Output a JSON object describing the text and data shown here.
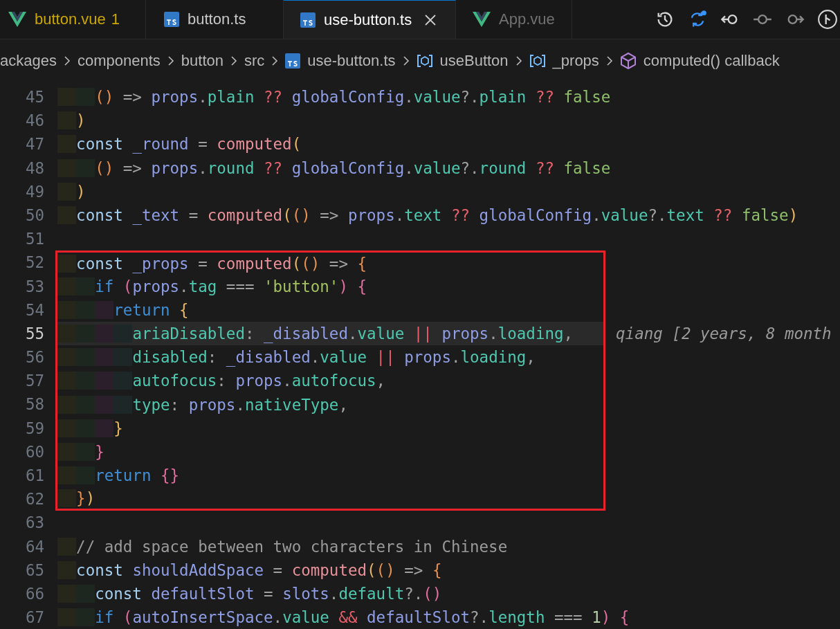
{
  "tabs": [
    {
      "label": "button.vue",
      "kind": "vue",
      "badge": "1",
      "selected": false,
      "dimmed": false
    },
    {
      "label": "button.ts",
      "kind": "ts",
      "selected": false,
      "dimmed": false
    },
    {
      "label": "use-button.ts",
      "kind": "ts",
      "selected": true,
      "dimmed": false
    },
    {
      "label": "App.vue",
      "kind": "vue",
      "selected": false,
      "dimmed": true
    }
  ],
  "breadcrumb": [
    {
      "kind": "folder",
      "label": "ackages"
    },
    {
      "kind": "folder",
      "label": "components"
    },
    {
      "kind": "folder",
      "label": "button"
    },
    {
      "kind": "folder",
      "label": "src"
    },
    {
      "kind": "file",
      "label": "use-button.ts"
    },
    {
      "kind": "symbol",
      "label": "useButton"
    },
    {
      "kind": "symbol",
      "label": "_props"
    },
    {
      "kind": "method",
      "label": "computed() callback"
    }
  ],
  "lines": [
    {
      "number": "45",
      "boxed": false,
      "current": false,
      "segments": [
        {
          "text": "    ()",
          "color": "#e8904c"
        },
        {
          "text": " => ",
          "color": "#a0a0a0"
        },
        {
          "text": "props",
          "color": "#8f9ee6"
        },
        {
          "text": ".",
          "color": "#a0a0a0"
        },
        {
          "text": "plain",
          "color": "#4ec9b0"
        },
        {
          "text": " ?? ",
          "color": "#e5606a"
        },
        {
          "text": "globalConfig",
          "color": "#8f9ee6"
        },
        {
          "text": ".",
          "color": "#a0a0a0"
        },
        {
          "text": "value",
          "color": "#4ec9b0"
        },
        {
          "text": "?.",
          "color": "#a0a0a0"
        },
        {
          "text": "plain",
          "color": "#4ec9b0"
        },
        {
          "text": " ?? ",
          "color": "#e5606a"
        },
        {
          "text": "false",
          "color": "#8fbf6a"
        }
      ]
    },
    {
      "number": "46",
      "boxed": false,
      "current": false,
      "segments": [
        {
          "text": "  )",
          "color": "#eab860"
        }
      ]
    },
    {
      "number": "47",
      "boxed": false,
      "current": false,
      "segments": [
        {
          "text": "  const ",
          "color": "#a6d0f0"
        },
        {
          "text": "_round",
          "color": "#8f9ee6"
        },
        {
          "text": " = ",
          "color": "#a0a0a0"
        },
        {
          "text": "computed",
          "color": "#e8919a"
        },
        {
          "text": "(",
          "color": "#eab860"
        }
      ]
    },
    {
      "number": "48",
      "boxed": false,
      "current": false,
      "segments": [
        {
          "text": "    ()",
          "color": "#e8904c"
        },
        {
          "text": " => ",
          "color": "#a0a0a0"
        },
        {
          "text": "props",
          "color": "#8f9ee6"
        },
        {
          "text": ".",
          "color": "#a0a0a0"
        },
        {
          "text": "round",
          "color": "#4ec9b0"
        },
        {
          "text": " ?? ",
          "color": "#e5606a"
        },
        {
          "text": "globalConfig",
          "color": "#8f9ee6"
        },
        {
          "text": ".",
          "color": "#a0a0a0"
        },
        {
          "text": "value",
          "color": "#4ec9b0"
        },
        {
          "text": "?.",
          "color": "#a0a0a0"
        },
        {
          "text": "round",
          "color": "#4ec9b0"
        },
        {
          "text": " ?? ",
          "color": "#e5606a"
        },
        {
          "text": "false",
          "color": "#8fbf6a"
        }
      ]
    },
    {
      "number": "49",
      "boxed": false,
      "current": false,
      "segments": [
        {
          "text": "  )",
          "color": "#eab860"
        }
      ]
    },
    {
      "number": "50",
      "boxed": false,
      "current": false,
      "segments": [
        {
          "text": "  const ",
          "color": "#a6d0f0"
        },
        {
          "text": "_text",
          "color": "#8f9ee6"
        },
        {
          "text": " = ",
          "color": "#a0a0a0"
        },
        {
          "text": "computed",
          "color": "#e8919a"
        },
        {
          "text": "(",
          "color": "#eab860"
        },
        {
          "text": "()",
          "color": "#e8904c"
        },
        {
          "text": " => ",
          "color": "#a0a0a0"
        },
        {
          "text": "props",
          "color": "#8f9ee6"
        },
        {
          "text": ".",
          "color": "#a0a0a0"
        },
        {
          "text": "text",
          "color": "#4ec9b0"
        },
        {
          "text": " ?? ",
          "color": "#e5606a"
        },
        {
          "text": "globalConfig",
          "color": "#8f9ee6"
        },
        {
          "text": ".",
          "color": "#a0a0a0"
        },
        {
          "text": "value",
          "color": "#4ec9b0"
        },
        {
          "text": "?.",
          "color": "#a0a0a0"
        },
        {
          "text": "text",
          "color": "#4ec9b0"
        },
        {
          "text": " ?? ",
          "color": "#e5606a"
        },
        {
          "text": "false",
          "color": "#8fbf6a"
        },
        {
          "text": ")",
          "color": "#eab860"
        }
      ]
    },
    {
      "number": "51",
      "boxed": false,
      "current": false
    },
    {
      "number": "52",
      "boxed": true,
      "current": false,
      "segments": [
        {
          "text": "  const ",
          "color": "#a6d0f0"
        },
        {
          "text": "_props",
          "color": "#8f9ee6"
        },
        {
          "text": " = ",
          "color": "#a0a0a0"
        },
        {
          "text": "computed",
          "color": "#e8919a"
        },
        {
          "text": "(",
          "color": "#eab860"
        },
        {
          "text": "()",
          "color": "#e8904c"
        },
        {
          "text": " => ",
          "color": "#a0a0a0"
        },
        {
          "text": "{",
          "color": "#e8904c"
        }
      ]
    },
    {
      "number": "53",
      "boxed": true,
      "current": false,
      "segments": [
        {
          "text": "    if ",
          "color": "#3f8fd6"
        },
        {
          "text": "(",
          "color": "#e06fa0"
        },
        {
          "text": "props",
          "color": "#8f9ee6"
        },
        {
          "text": ".",
          "color": "#a0a0a0"
        },
        {
          "text": "tag",
          "color": "#4ec9b0"
        },
        {
          "text": " === ",
          "color": "#a0a0a0"
        },
        {
          "text": "'button'",
          "color": "#a5c261"
        },
        {
          "text": ") {",
          "color": "#e06fa0"
        }
      ]
    },
    {
      "number": "54",
      "boxed": true,
      "current": false,
      "segments": [
        {
          "text": "      return ",
          "color": "#3f8fd6"
        },
        {
          "text": "{",
          "color": "#eab860"
        }
      ]
    },
    {
      "number": "55",
      "boxed": true,
      "current": true,
      "blame": "qiang [2 years, 8 month",
      "segments": [
        {
          "text": "        ariaDisabled",
          "color": "#4ec9b0"
        },
        {
          "text": ": ",
          "color": "#a0a0a0"
        },
        {
          "text": "_disabled",
          "color": "#8f9ee6"
        },
        {
          "text": ".",
          "color": "#a0a0a0"
        },
        {
          "text": "value",
          "color": "#4ec9b0"
        },
        {
          "text": " || ",
          "color": "#e5606a"
        },
        {
          "text": "props",
          "color": "#8f9ee6"
        },
        {
          "text": ".",
          "color": "#a0a0a0"
        },
        {
          "text": "loading",
          "color": "#4ec9b0"
        },
        {
          "text": ",",
          "color": "#a0a0a0"
        }
      ]
    },
    {
      "number": "56",
      "boxed": true,
      "current": false,
      "segments": [
        {
          "text": "        disabled",
          "color": "#4ec9b0"
        },
        {
          "text": ": ",
          "color": "#a0a0a0"
        },
        {
          "text": "_disabled",
          "color": "#8f9ee6"
        },
        {
          "text": ".",
          "color": "#a0a0a0"
        },
        {
          "text": "value",
          "color": "#4ec9b0"
        },
        {
          "text": " || ",
          "color": "#e5606a"
        },
        {
          "text": "props",
          "color": "#8f9ee6"
        },
        {
          "text": ".",
          "color": "#a0a0a0"
        },
        {
          "text": "loading",
          "color": "#4ec9b0"
        },
        {
          "text": ",",
          "color": "#a0a0a0"
        }
      ]
    },
    {
      "number": "57",
      "boxed": true,
      "current": false,
      "segments": [
        {
          "text": "        autofocus",
          "color": "#4ec9b0"
        },
        {
          "text": ": ",
          "color": "#a0a0a0"
        },
        {
          "text": "props",
          "color": "#8f9ee6"
        },
        {
          "text": ".",
          "color": "#a0a0a0"
        },
        {
          "text": "autofocus",
          "color": "#4ec9b0"
        },
        {
          "text": ",",
          "color": "#a0a0a0"
        }
      ]
    },
    {
      "number": "58",
      "boxed": true,
      "current": false,
      "segments": [
        {
          "text": "        type",
          "color": "#4ec9b0"
        },
        {
          "text": ": ",
          "color": "#a0a0a0"
        },
        {
          "text": "props",
          "color": "#8f9ee6"
        },
        {
          "text": ".",
          "color": "#a0a0a0"
        },
        {
          "text": "nativeType",
          "color": "#4ec9b0"
        },
        {
          "text": ",",
          "color": "#a0a0a0"
        }
      ]
    },
    {
      "number": "59",
      "boxed": true,
      "current": false,
      "segments": [
        {
          "text": "      }",
          "color": "#eab860"
        }
      ]
    },
    {
      "number": "60",
      "boxed": true,
      "current": false,
      "segments": [
        {
          "text": "    }",
          "color": "#e06fa0"
        }
      ]
    },
    {
      "number": "61",
      "boxed": true,
      "current": false,
      "segments": [
        {
          "text": "    return ",
          "color": "#3f8fd6"
        },
        {
          "text": "{}",
          "color": "#e06fa0"
        }
      ]
    },
    {
      "number": "62",
      "boxed": true,
      "current": false,
      "segments": [
        {
          "text": "  }",
          "color": "#e8904c"
        },
        {
          "text": ")",
          "color": "#eab860"
        }
      ]
    },
    {
      "number": "63",
      "boxed": false,
      "current": false
    },
    {
      "number": "64",
      "boxed": false,
      "current": false,
      "segments": [
        {
          "text": "  // add space between two characters in Chinese",
          "color": "#9a9a9a"
        }
      ]
    },
    {
      "number": "65",
      "boxed": false,
      "current": false,
      "segments": [
        {
          "text": "  const ",
          "color": "#a6d0f0"
        },
        {
          "text": "shouldAddSpace",
          "color": "#8f9ee6"
        },
        {
          "text": " = ",
          "color": "#a0a0a0"
        },
        {
          "text": "computed",
          "color": "#e8919a"
        },
        {
          "text": "(",
          "color": "#eab860"
        },
        {
          "text": "()",
          "color": "#e8904c"
        },
        {
          "text": " => ",
          "color": "#a0a0a0"
        },
        {
          "text": "{",
          "color": "#e8904c"
        }
      ]
    },
    {
      "number": "66",
      "boxed": false,
      "current": false,
      "segments": [
        {
          "text": "    const ",
          "color": "#a6d0f0"
        },
        {
          "text": "defaultSlot",
          "color": "#8f9ee6"
        },
        {
          "text": " = ",
          "color": "#a0a0a0"
        },
        {
          "text": "slots",
          "color": "#8f9ee6"
        },
        {
          "text": ".",
          "color": "#a0a0a0"
        },
        {
          "text": "default",
          "color": "#4ec9b0"
        },
        {
          "text": "?.",
          "color": "#a0a0a0"
        },
        {
          "text": "()",
          "color": "#e06fa0"
        }
      ]
    },
    {
      "number": "67",
      "boxed": false,
      "current": false,
      "segments": [
        {
          "text": "    if ",
          "color": "#3f8fd6"
        },
        {
          "text": "(",
          "color": "#e06fa0"
        },
        {
          "text": "autoInsertSpace",
          "color": "#8f9ee6"
        },
        {
          "text": ".",
          "color": "#a0a0a0"
        },
        {
          "text": "value",
          "color": "#4ec9b0"
        },
        {
          "text": " && ",
          "color": "#e5606a"
        },
        {
          "text": "defaultSlot",
          "color": "#8f9ee6"
        },
        {
          "text": "?.",
          "color": "#a0a0a0"
        },
        {
          "text": "length",
          "color": "#4ec9b0"
        },
        {
          "text": " === ",
          "color": "#a0a0a0"
        },
        {
          "text": "1",
          "color": "#b5cea8"
        },
        {
          "text": ") {",
          "color": "#e06fa0"
        }
      ]
    }
  ]
}
